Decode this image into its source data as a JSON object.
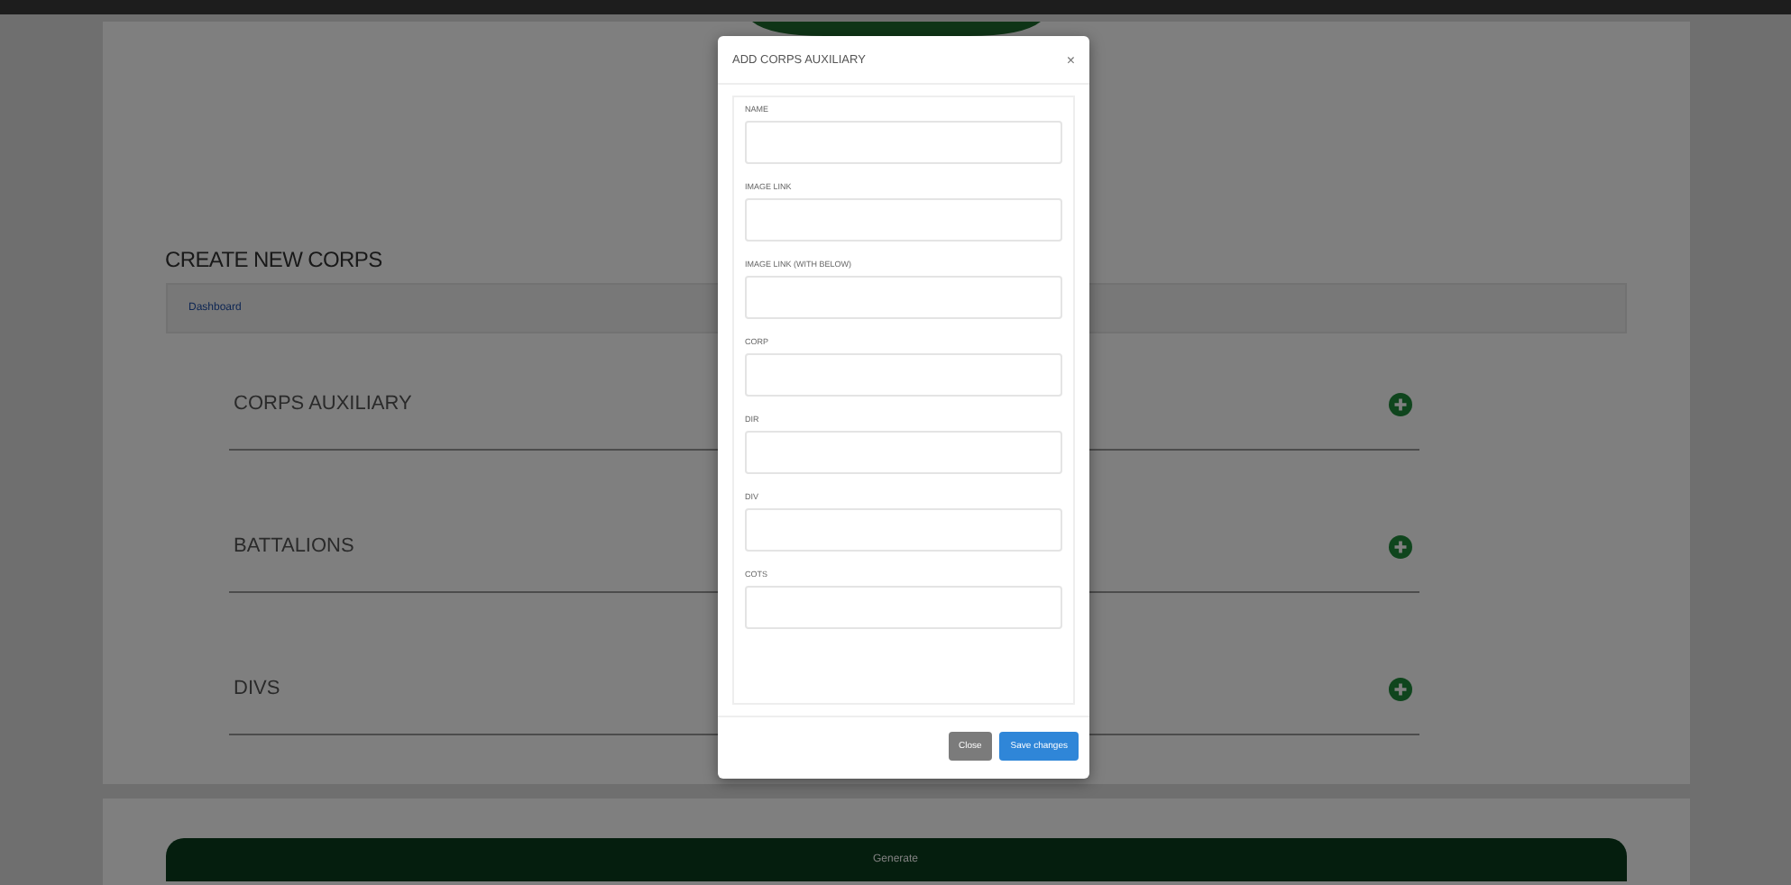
{
  "page": {
    "title": "CREATE NEW CORPS",
    "breadcrumb": [
      {
        "label": "Dashboard"
      }
    ],
    "sections": [
      {
        "title": "CORPS AUXILIARY"
      },
      {
        "title": "BATTALIONS"
      },
      {
        "title": "DIVS"
      }
    ],
    "generate_button": "Generate"
  },
  "modal": {
    "title": "ADD CORPS AUXILIARY",
    "close": "×",
    "fields": [
      {
        "label": "NAME"
      },
      {
        "label": "IMAGE LINK"
      },
      {
        "label": "IMAGE LINK (WITH BELOW)"
      },
      {
        "label": "CORP"
      },
      {
        "label": "DIR"
      },
      {
        "label": "DIV"
      },
      {
        "label": "COTS"
      }
    ],
    "buttons": [
      {
        "label": "Close",
        "kind": "secondary"
      },
      {
        "label": "Save changes",
        "kind": "primary"
      }
    ]
  }
}
